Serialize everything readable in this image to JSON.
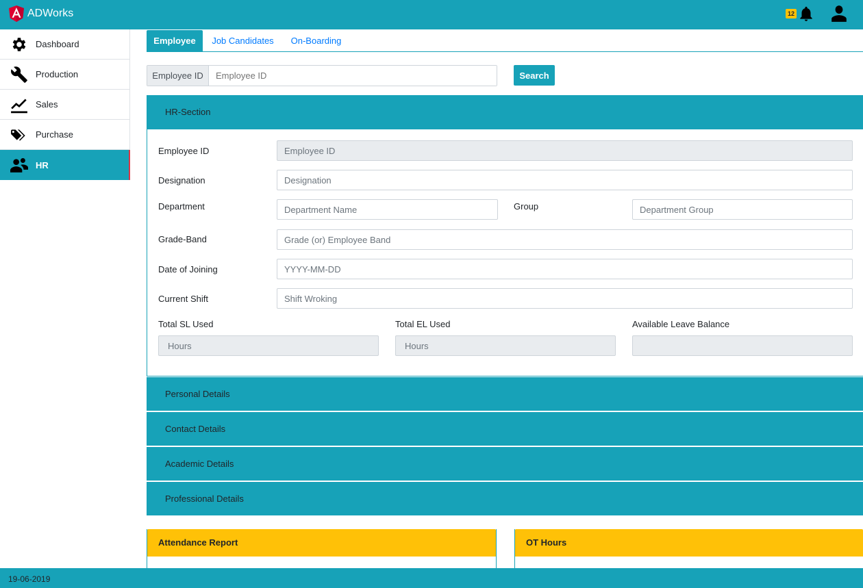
{
  "app": {
    "title": "ADWorks",
    "notification_count": "12"
  },
  "sidebar": {
    "items": [
      {
        "label": "Dashboard"
      },
      {
        "label": "Production"
      },
      {
        "label": "Sales"
      },
      {
        "label": "Purchase"
      },
      {
        "label": "HR",
        "active": true
      }
    ]
  },
  "tabs": [
    {
      "label": "Employee",
      "active": true
    },
    {
      "label": "Job Candidates"
    },
    {
      "label": "On-Boarding"
    }
  ],
  "search": {
    "prefix": "Employee ID",
    "placeholder": "Employee ID",
    "button": "Search"
  },
  "hr_section": {
    "title": "HR-Section",
    "employee_id": {
      "label": "Employee ID",
      "placeholder": "Employee ID"
    },
    "designation": {
      "label": "Designation",
      "placeholder": "Designation"
    },
    "department": {
      "label": "Department",
      "placeholder": "Department Name"
    },
    "group": {
      "label": "Group",
      "placeholder": "Department Group"
    },
    "grade_band": {
      "label": "Grade-Band",
      "placeholder": "Grade (or) Employee Band"
    },
    "date_of_joining": {
      "label": "Date of Joining",
      "placeholder": "YYYY-MM-DD"
    },
    "current_shift": {
      "label": "Current Shift",
      "placeholder": "Shift Wroking"
    },
    "total_sl": {
      "label": "Total SL Used",
      "placeholder": "Hours"
    },
    "total_el": {
      "label": "Total EL Used",
      "placeholder": "Hours"
    },
    "leave_balance": {
      "label": "Available Leave Balance",
      "placeholder": ""
    }
  },
  "accordion": [
    {
      "title": "Personal Details"
    },
    {
      "title": "Contact Details"
    },
    {
      "title": "Academic Details"
    },
    {
      "title": "Professional Details"
    }
  ],
  "cards": [
    {
      "title": "Attendance Report"
    },
    {
      "title": "OT Hours"
    }
  ],
  "footer": {
    "date": "19-06-2019"
  },
  "colors": {
    "primary": "#17a2b8",
    "warning": "#ffc107",
    "accent_red": "#dc3545",
    "brand_red": "#dd0031"
  }
}
